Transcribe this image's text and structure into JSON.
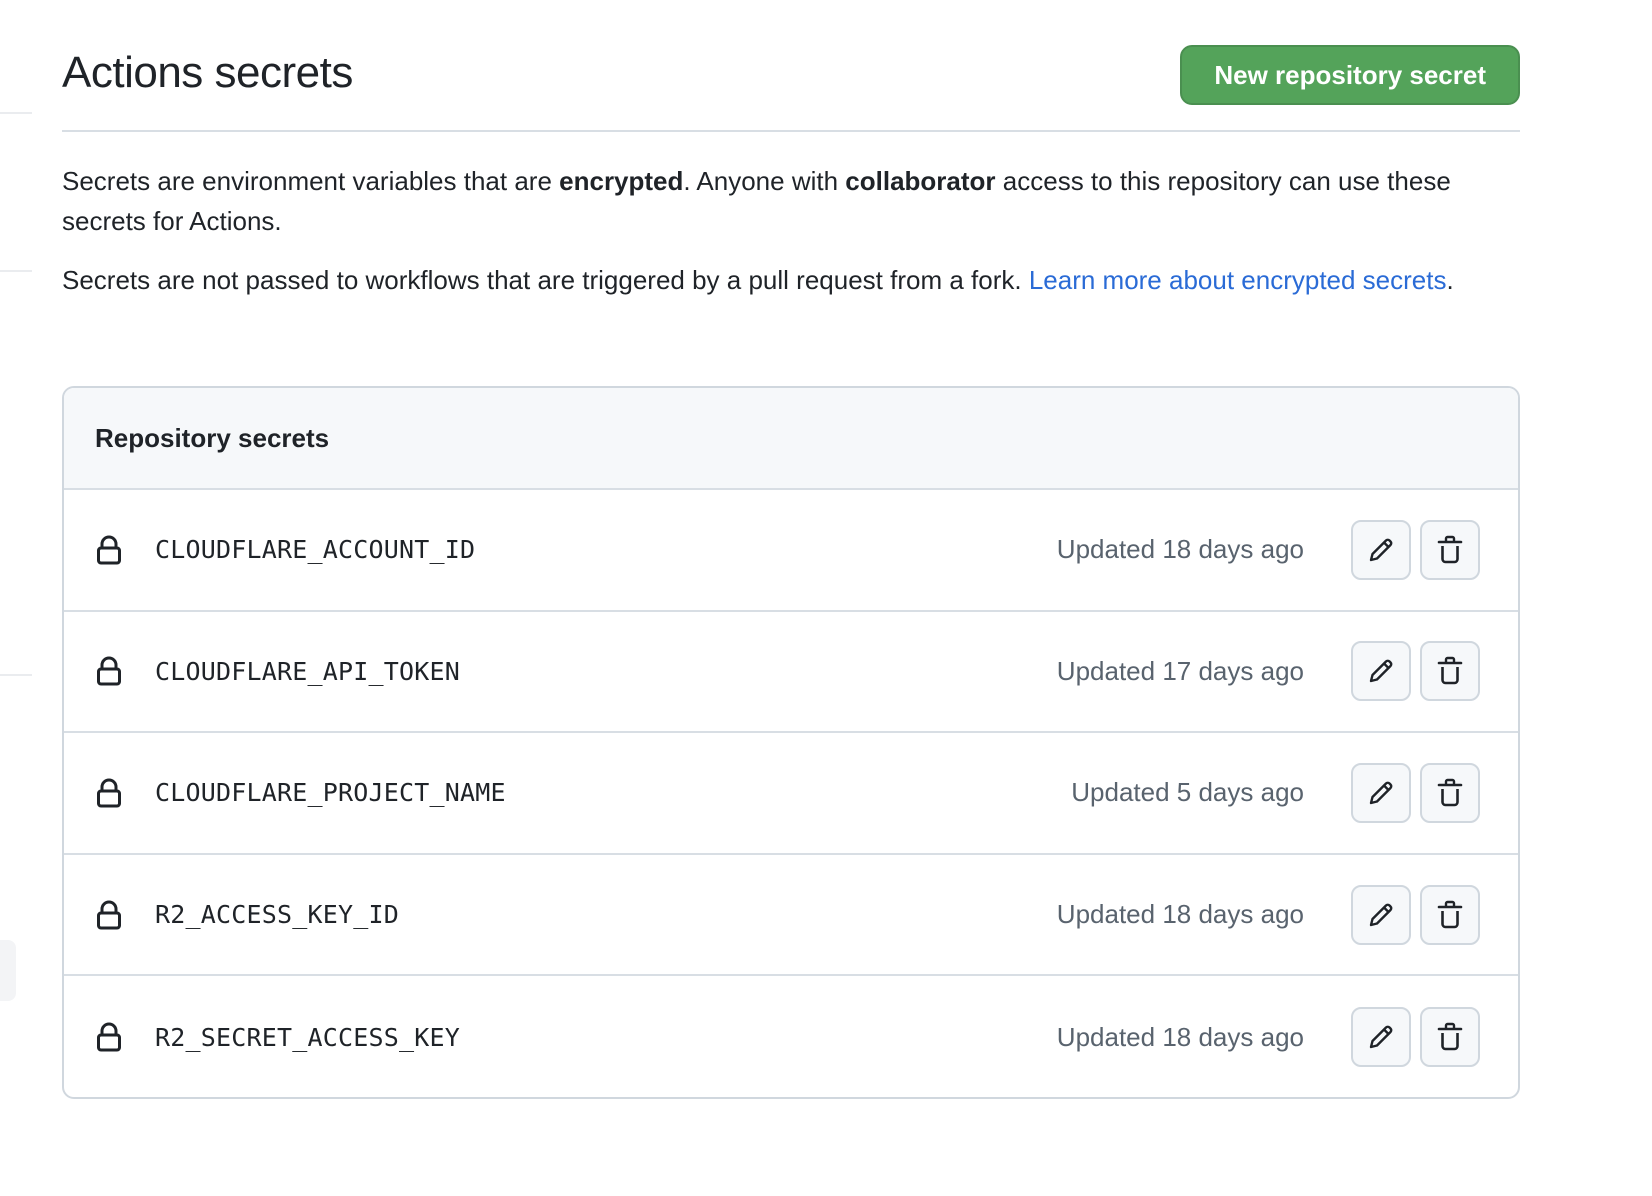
{
  "header": {
    "title": "Actions secrets",
    "new_secret_button": "New repository secret"
  },
  "description": {
    "p1_part1": "Secrets are environment variables that are ",
    "p1_bold1": "encrypted",
    "p1_part2": ". Anyone with ",
    "p1_bold2": "collaborator",
    "p1_part3": " access to this repository can use these secrets for Actions.",
    "p2_text": "Secrets are not passed to workflows that are triggered by a pull request from a fork. ",
    "p2_link": "Learn more about encrypted secrets",
    "p2_end": "."
  },
  "secrets_box": {
    "title": "Repository secrets",
    "rows": [
      {
        "name": "CLOUDFLARE_ACCOUNT_ID",
        "updated": "Updated 18 days ago",
        "icon": "lock-icon"
      },
      {
        "name": "CLOUDFLARE_API_TOKEN",
        "updated": "Updated 17 days ago",
        "icon": "lock-icon"
      },
      {
        "name": "CLOUDFLARE_PROJECT_NAME",
        "updated": "Updated 5 days ago",
        "icon": "lock-icon"
      },
      {
        "name": "R2_ACCESS_KEY_ID",
        "updated": "Updated 18 days ago",
        "icon": "lock-icon"
      },
      {
        "name": "R2_SECRET_ACCESS_KEY",
        "updated": "Updated 18 days ago",
        "icon": "lock-icon"
      }
    ],
    "row_actions": {
      "edit_icon": "pencil-icon",
      "delete_icon": "trash-icon"
    }
  },
  "colors": {
    "primary_button": "#54a35a",
    "link": "#2a6bd6",
    "muted_text": "#59636e",
    "border": "#d0d7de"
  }
}
